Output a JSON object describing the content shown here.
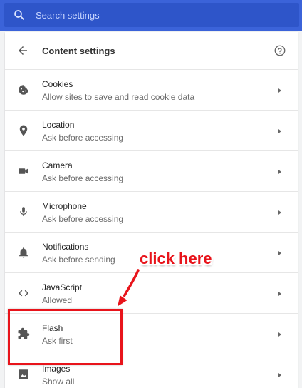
{
  "search": {
    "placeholder": "Search settings",
    "icon": "search-icon"
  },
  "header": {
    "title": "Content settings",
    "back_icon": "arrow-back-icon",
    "help_icon": "help-icon"
  },
  "rows": [
    {
      "label": "Cookies",
      "sub": "Allow sites to save and read cookie data",
      "icon": "cookie-icon"
    },
    {
      "label": "Location",
      "sub": "Ask before accessing",
      "icon": "location-pin-icon"
    },
    {
      "label": "Camera",
      "sub": "Ask before accessing",
      "icon": "camera-icon"
    },
    {
      "label": "Microphone",
      "sub": "Ask before accessing",
      "icon": "microphone-icon"
    },
    {
      "label": "Notifications",
      "sub": "Ask before sending",
      "icon": "bell-icon"
    },
    {
      "label": "JavaScript",
      "sub": "Allowed",
      "icon": "code-icon"
    },
    {
      "label": "Flash",
      "sub": "Ask first",
      "icon": "puzzle-icon"
    },
    {
      "label": "Images",
      "sub": "Show all",
      "icon": "image-icon"
    }
  ],
  "annotation": {
    "text": "click here",
    "color": "#e8141b"
  },
  "colors": {
    "topbar": "#3b63d9",
    "accent_red": "#e8141b"
  }
}
